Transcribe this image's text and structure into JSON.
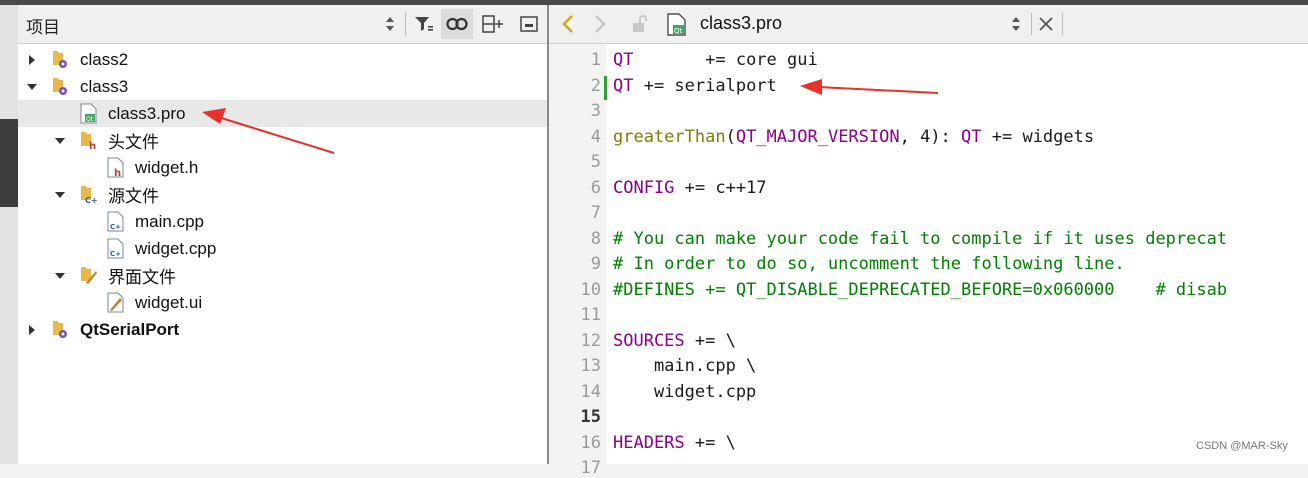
{
  "project_panel": {
    "title": "项目",
    "tree": [
      {
        "label": "class2",
        "type": "project",
        "expanded": false
      },
      {
        "label": "class3",
        "type": "project",
        "expanded": true
      },
      {
        "label": "class3.pro",
        "type": "pro-file",
        "selected": true
      },
      {
        "label": "头文件",
        "type": "folder-headers",
        "expanded": true
      },
      {
        "label": "widget.h",
        "type": "h-file"
      },
      {
        "label": "源文件",
        "type": "folder-sources",
        "expanded": true
      },
      {
        "label": "main.cpp",
        "type": "cpp-file"
      },
      {
        "label": "widget.cpp",
        "type": "cpp-file"
      },
      {
        "label": "界面文件",
        "type": "folder-forms",
        "expanded": true
      },
      {
        "label": "widget.ui",
        "type": "ui-file"
      },
      {
        "label": "QtSerialPort",
        "type": "project",
        "expanded": false,
        "bold": true
      }
    ]
  },
  "editor": {
    "file_name": "class3.pro",
    "current_line": "15",
    "lines": [
      {
        "n": "1",
        "text": "QT       += core gui"
      },
      {
        "n": "2",
        "text": "QT += serialport"
      },
      {
        "n": "3",
        "text": ""
      },
      {
        "n": "4",
        "text": "greaterThan(QT_MAJOR_VERSION, 4): QT += widgets"
      },
      {
        "n": "5",
        "text": ""
      },
      {
        "n": "6",
        "text": "CONFIG += c++17"
      },
      {
        "n": "7",
        "text": ""
      },
      {
        "n": "8",
        "text": "# You can make your code fail to compile if it uses deprecat"
      },
      {
        "n": "9",
        "text": "# In order to do so, uncomment the following line."
      },
      {
        "n": "10",
        "text": "#DEFINES += QT_DISABLE_DEPRECATED_BEFORE=0x060000    # disab"
      },
      {
        "n": "11",
        "text": ""
      },
      {
        "n": "12",
        "text": "SOURCES += \\"
      },
      {
        "n": "13",
        "text": "    main.cpp \\"
      },
      {
        "n": "14",
        "text": "    widget.cpp"
      },
      {
        "n": "15",
        "text": ""
      },
      {
        "n": "16",
        "text": "HEADERS += \\"
      },
      {
        "n": "17",
        "text": ""
      }
    ]
  },
  "watermark": "CSDN @MAR-Sky",
  "colors": {
    "keyword": "#8b008b",
    "function": "#808000",
    "comment": "#008000",
    "arrow": "#e8312a"
  }
}
